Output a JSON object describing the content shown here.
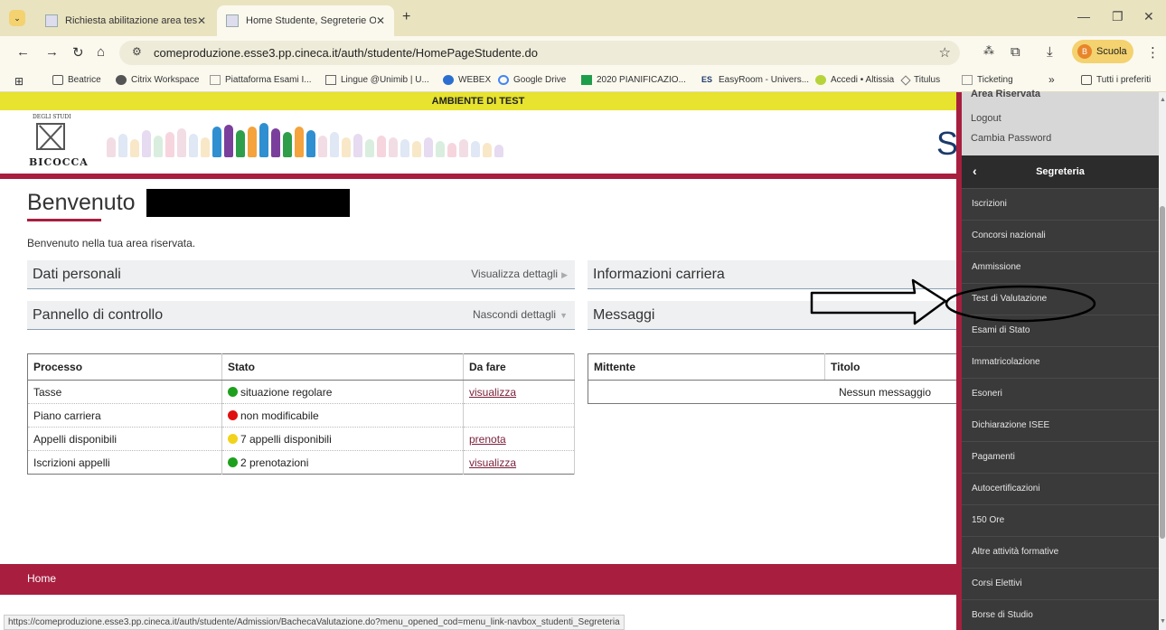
{
  "browser": {
    "tabs": [
      {
        "title": "Richiesta abilitazione area test"
      },
      {
        "title": "Home Studente, Segreterie Onl"
      }
    ],
    "new_tab_icon": "plus-icon",
    "url": "comeproduzione.esse3.pp.cineca.it/auth/studente/HomePageStudente.do",
    "profile_initial": "B",
    "profile_label": "Scuola",
    "bookmarks": [
      "Beatrice",
      "Citrix Workspace",
      "Piattaforma Esami I...",
      "Lingue @Unimib | U...",
      "WEBEX",
      "Google Drive",
      "2020 PIANIFICAZIO...",
      "EasyRoom - Univers...",
      "Accedi • Altissia",
      "Titulus",
      "Ticketing"
    ],
    "bookmarks_overflow": "»",
    "all_bookmarks": "Tutti i preferiti",
    "status_url": "https://comeproduzione.esse3.pp.cineca.it/auth/studente/Admission/BachecaValutazione.do?menu_opened_cod=menu_link-navbox_studenti_Segreteria"
  },
  "page": {
    "env_banner": "AMBIENTE DI TEST",
    "logo_top": "DEGLI STUDI",
    "logo_text": "BICOCCA",
    "brand_letter": "S",
    "welcome_title": "Benvenuto",
    "intro": "Benvenuto nella tua area riservata.",
    "sections": {
      "personal": {
        "title": "Dati personali",
        "action": "Visualizza dettagli"
      },
      "career": {
        "title": "Informazioni carriera"
      },
      "control": {
        "title": "Pannello di controllo",
        "action": "Nascondi dettagli"
      },
      "messages": {
        "title": "Messaggi"
      }
    },
    "process_table": {
      "headers": [
        "Processo",
        "Stato",
        "Da fare"
      ],
      "rows": [
        {
          "process": "Tasse",
          "status": "situazione regolare",
          "status_color": "#1ea01e",
          "todo": "visualizza"
        },
        {
          "process": "Piano carriera",
          "status": "non modificabile",
          "status_color": "#e01010",
          "todo": ""
        },
        {
          "process": "Appelli disponibili",
          "status": "7 appelli disponibili",
          "status_color": "#f2d21a",
          "todo": "prenota"
        },
        {
          "process": "Iscrizioni appelli",
          "status": "2 prenotazioni",
          "status_color": "#1ea01e",
          "todo": "visualizza"
        }
      ]
    },
    "messages_table": {
      "headers": [
        "Mittente",
        "Titolo"
      ],
      "empty": "Nessun messaggio"
    },
    "footer_home": "Home"
  },
  "sidebar": {
    "top_links": [
      "Area Riservata",
      "Logout",
      "Cambia Password"
    ],
    "section_title": "Segreteria",
    "items": [
      "Iscrizioni",
      "Concorsi nazionali",
      "Ammissione",
      "Test di Valutazione",
      "Esami di Stato",
      "Immatricolazione",
      "Esoneri",
      "Dichiarazione ISEE",
      "Pagamenti",
      "Autocertificazioni",
      "150 Ore",
      "Altre attività formative",
      "Corsi Elettivi",
      "Borse di Studio"
    ]
  },
  "colors": {
    "accent": "#a81e3f",
    "env_banner": "#e7e32e",
    "menu_bg": "#3a3a3a"
  }
}
